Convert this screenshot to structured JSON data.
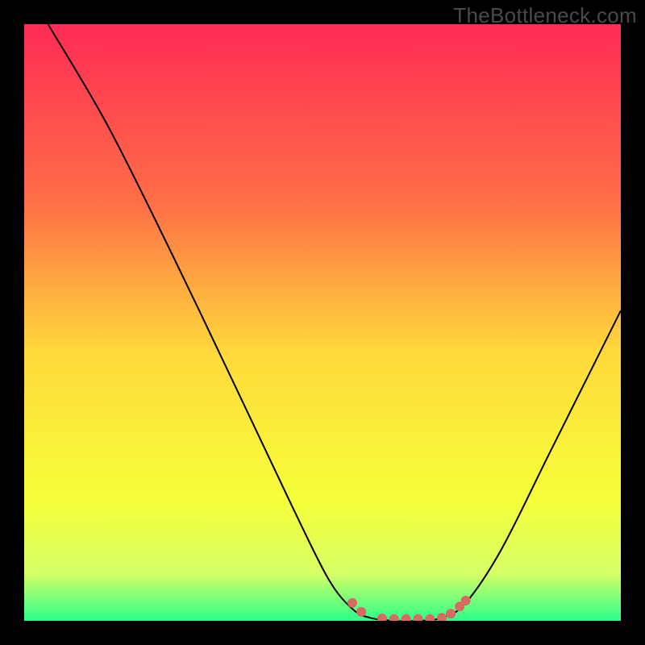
{
  "watermark": "TheBottleneck.com",
  "colors": {
    "bg": "#000000",
    "curve": "#000000",
    "marker_fill": "#d86a62",
    "marker_stroke": "#d86a62",
    "grad_top": "#ff2b55",
    "grad_mid1": "#ff6f47",
    "grad_mid2": "#ffd93b",
    "grad_mid3": "#f6ff3a",
    "grad_mid4": "#d7ff66",
    "grad_bottom": "#2bff89"
  },
  "chart_data": {
    "type": "line",
    "title": "",
    "xlabel": "",
    "ylabel": "",
    "xlim": [
      0,
      100
    ],
    "ylim": [
      0,
      100
    ],
    "curve": [
      {
        "x": 4,
        "y": 100
      },
      {
        "x": 14,
        "y": 83
      },
      {
        "x": 25,
        "y": 61
      },
      {
        "x": 36,
        "y": 38
      },
      {
        "x": 45,
        "y": 19
      },
      {
        "x": 51,
        "y": 7
      },
      {
        "x": 55,
        "y": 2
      },
      {
        "x": 58,
        "y": 0.5
      },
      {
        "x": 62,
        "y": 0
      },
      {
        "x": 66,
        "y": 0
      },
      {
        "x": 70,
        "y": 0.5
      },
      {
        "x": 74,
        "y": 3
      },
      {
        "x": 80,
        "y": 12
      },
      {
        "x": 88,
        "y": 28
      },
      {
        "x": 96,
        "y": 44
      },
      {
        "x": 100,
        "y": 52
      }
    ],
    "markers": [
      {
        "x": 55,
        "y": 3
      },
      {
        "x": 56.5,
        "y": 1.5
      },
      {
        "x": 60,
        "y": 0.4
      },
      {
        "x": 62,
        "y": 0.3
      },
      {
        "x": 64,
        "y": 0.3
      },
      {
        "x": 66,
        "y": 0.3
      },
      {
        "x": 68,
        "y": 0.3
      },
      {
        "x": 70,
        "y": 0.5
      },
      {
        "x": 71.5,
        "y": 1.2
      },
      {
        "x": 73,
        "y": 2.4
      },
      {
        "x": 74,
        "y": 3.4
      }
    ]
  }
}
